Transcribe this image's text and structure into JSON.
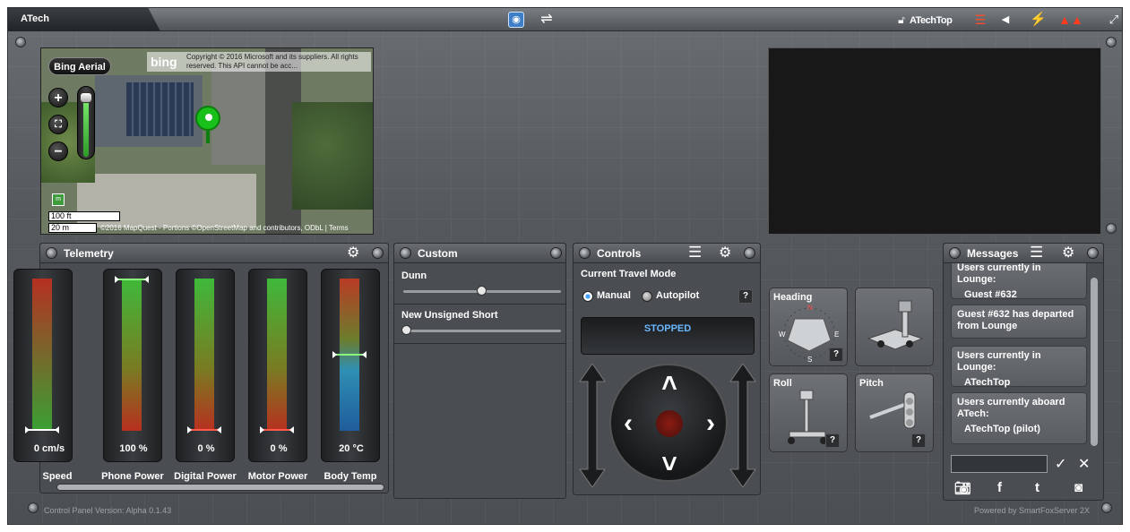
{
  "app": {
    "brand": "ATech"
  },
  "topbar": {
    "user_label": "ATechTop",
    "icons": [
      "nav-target-icon",
      "swap-icon",
      "lock-icon",
      "layers-icon",
      "back-icon",
      "power-icon",
      "robot-icon",
      "expand-icon"
    ],
    "accent_color": "#ff3b1f"
  },
  "map": {
    "type_button": "Bing Aerial",
    "logo": "bing",
    "copyright": "Copyright © 2016 Microsoft and its suppliers. All rights reserved. This API cannot be acc...",
    "zoom_in": "+",
    "zoom_out": "−",
    "scale_ft": "100 ft",
    "scale_m": "20 m",
    "attribution": "©2016 MapQuest - Portions ©OpenStreetMap and contributors, ODbL | Terms"
  },
  "telemetry": {
    "title": "Telemetry",
    "gauges": [
      {
        "label": "Speed",
        "value": "0 cm/s",
        "level": 0.0
      },
      {
        "label": "Phone Power",
        "value": "100 %",
        "level": 1.0
      },
      {
        "label": "Digital Power",
        "value": "0 %",
        "level": 0.0
      },
      {
        "label": "Motor Power",
        "value": "0 %",
        "level": 0.0
      },
      {
        "label": "Body Temp",
        "value": "20 °C",
        "level": 0.5
      }
    ]
  },
  "custom": {
    "title": "Custom",
    "sliders": [
      {
        "label": "Dunn",
        "value": 0.5
      },
      {
        "label": "New Unsigned Short",
        "value": 0.0
      }
    ]
  },
  "controls": {
    "title": "Controls",
    "travel_mode_label": "Current Travel Mode",
    "mode_manual": "Manual",
    "mode_autopilot": "Autopilot",
    "selected_mode": "Manual",
    "help": "?",
    "status": "STOPPED"
  },
  "attitude": {
    "heading_label": "Heading",
    "roll_label": "Roll",
    "pitch_label": "Pitch",
    "compass": {
      "w": "W",
      "e": "E",
      "s": "S",
      "n": "N"
    },
    "help": "?"
  },
  "messages": {
    "title": "Messages",
    "items": [
      {
        "header": "Users currently in Lounge:",
        "sub": "Guest #632"
      },
      {
        "header": "Guest #632 has departed from Lounge",
        "sub": ""
      },
      {
        "header": "Users currently in Lounge:",
        "sub": "ATechTop"
      },
      {
        "header": "Users currently aboard ATech:",
        "sub": "ATechTop (pilot)"
      }
    ],
    "input_value": "",
    "send": "✓",
    "clear": "✕",
    "social_icons": [
      "camera-icon",
      "facebook-icon",
      "twitter-icon",
      "instagram-icon"
    ]
  },
  "footer": {
    "version": "Control Panel Version: Alpha 0.1.43",
    "powered": "Powered by SmartFoxServer 2X"
  }
}
